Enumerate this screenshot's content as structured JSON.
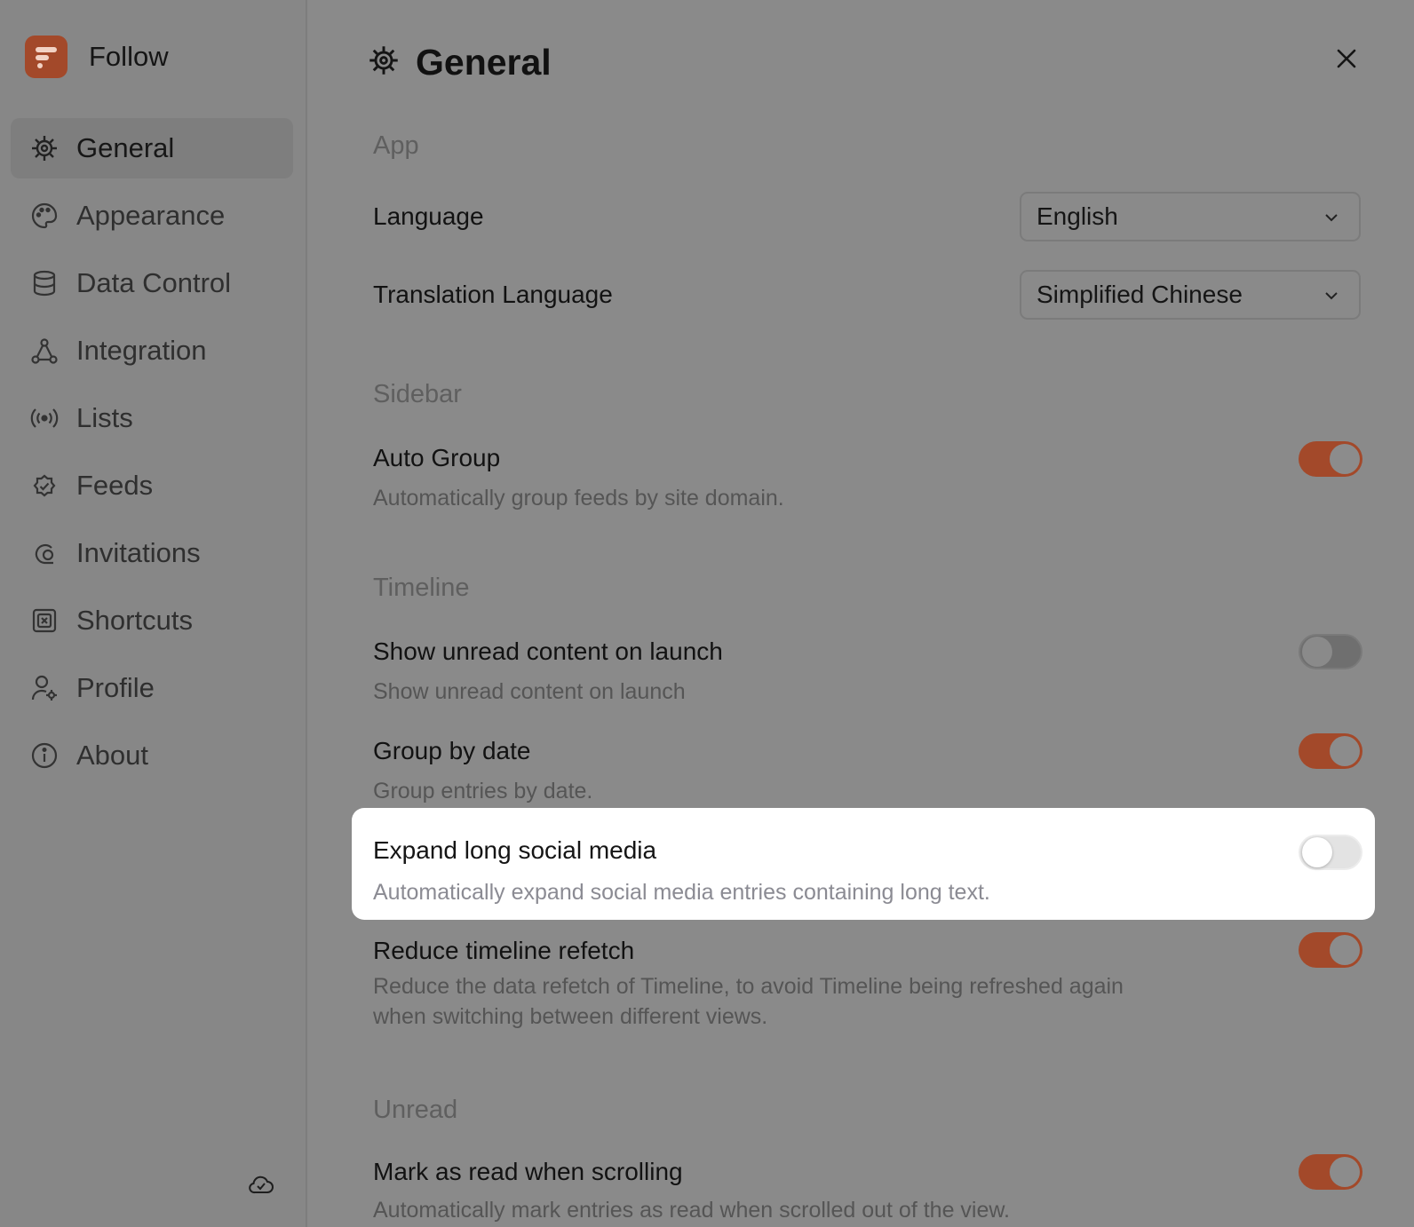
{
  "app": {
    "name": "Follow",
    "accent_color": "#a3492a"
  },
  "sidebar": {
    "items": [
      {
        "label": "General",
        "icon": "gear-icon",
        "active": true
      },
      {
        "label": "Appearance",
        "icon": "palette-icon"
      },
      {
        "label": "Data Control",
        "icon": "database-icon"
      },
      {
        "label": "Integration",
        "icon": "integration-icon"
      },
      {
        "label": "Lists",
        "icon": "broadcast-icon"
      },
      {
        "label": "Feeds",
        "icon": "badge-check-icon"
      },
      {
        "label": "Invitations",
        "icon": "invitation-icon"
      },
      {
        "label": "Shortcuts",
        "icon": "keyboard-icon"
      },
      {
        "label": "Profile",
        "icon": "user-settings-icon"
      },
      {
        "label": "About",
        "icon": "info-icon"
      }
    ],
    "footer_icon": "cloud-check-icon"
  },
  "header": {
    "title": "General"
  },
  "sections": {
    "app": "App",
    "sidebar": "Sidebar",
    "timeline": "Timeline",
    "unread": "Unread"
  },
  "settings": {
    "language": {
      "label": "Language",
      "value": "English"
    },
    "translation_language": {
      "label": "Translation Language",
      "value": "Simplified Chinese"
    },
    "auto_group": {
      "title": "Auto Group",
      "desc": "Automatically group feeds by site domain.",
      "on": true
    },
    "show_unread": {
      "title": "Show unread content on launch",
      "desc": "Show unread content on launch",
      "on": false
    },
    "group_by_date": {
      "title": "Group by date",
      "desc": "Group entries by date.",
      "on": true
    },
    "expand_social": {
      "title": "Expand long social media",
      "desc": "Automatically expand social media entries containing long text.",
      "on": false
    },
    "reduce_refetch": {
      "title": "Reduce timeline refetch",
      "desc": "Reduce the data refetch of Timeline, to avoid Timeline being refreshed again when switching between different views.",
      "on": true
    },
    "mark_read_scroll": {
      "title": "Mark as read when scrolling",
      "desc": "Automatically mark entries as read when scrolled out of the view.",
      "on": true
    }
  }
}
